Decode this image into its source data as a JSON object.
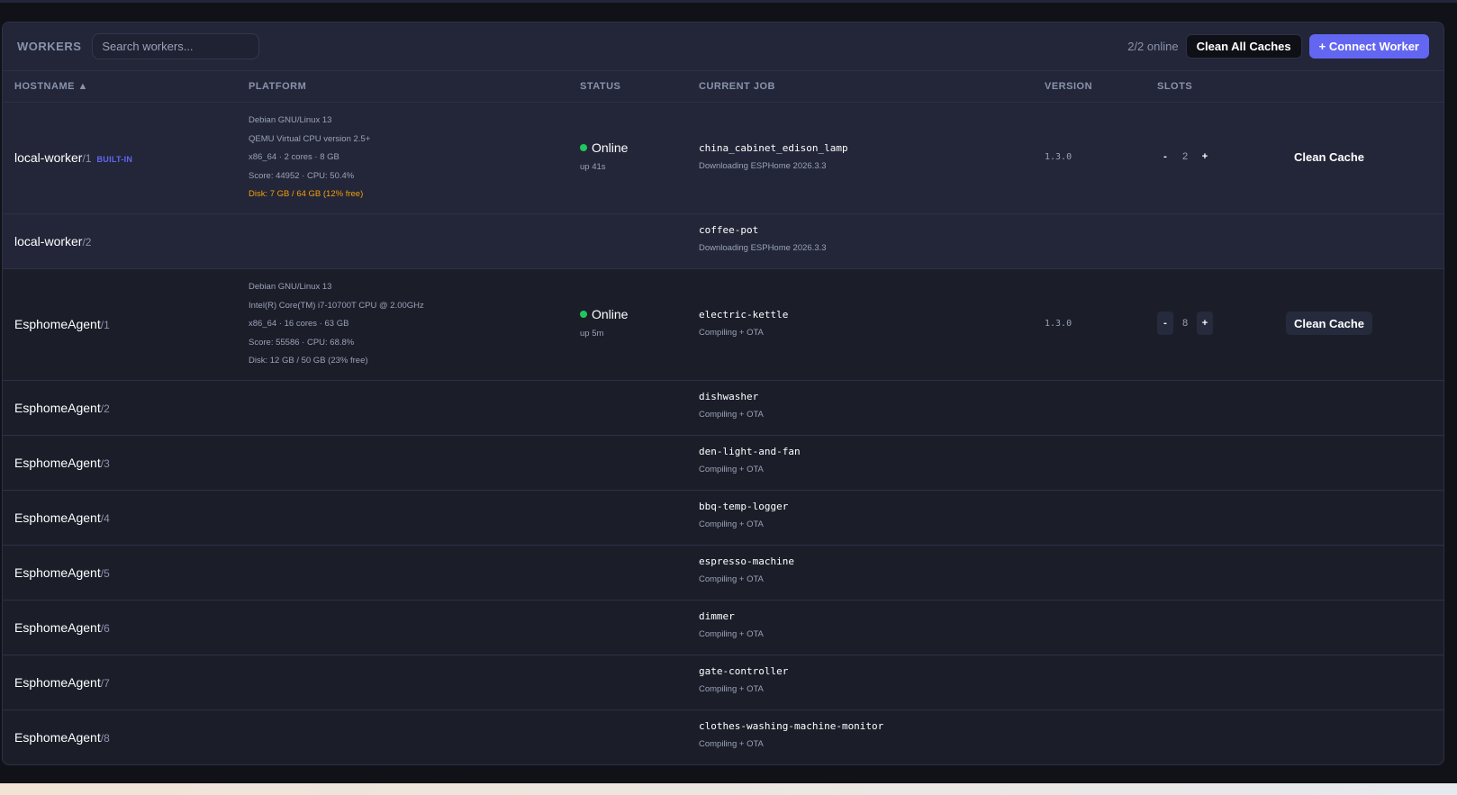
{
  "header": {
    "title": "WORKERS",
    "search_placeholder": "Search workers...",
    "online": "2/2 online",
    "clean_all": "Clean All Caches",
    "connect": "+ Connect Worker"
  },
  "columns": {
    "hostname": "HOSTNAME ▲",
    "platform": "PLATFORM",
    "status": "STATUS",
    "job": "CURRENT JOB",
    "version": "VERSION",
    "slots": "SLOTS"
  },
  "workers": [
    {
      "host": "local-worker",
      "idx": "/1",
      "badge": "BUILT-IN",
      "platform": [
        "Debian GNU/Linux 13",
        "QEMU Virtual CPU version 2.5+",
        "x86_64 · 2 cores · 8 GB",
        "Score: 44952 · CPU: 50.4%"
      ],
      "disk": "Disk: 7 GB / 64 GB (12% free)",
      "status": "Online",
      "uptime": "up 41s",
      "job": "china_cabinet_edison_lamp",
      "job_status": "Downloading ESPHome 2026.3.3",
      "version": "1.3.0",
      "slots": "2",
      "clean": "Clean Cache"
    },
    {
      "host": "local-worker",
      "idx": "/2",
      "job": "coffee-pot",
      "job_status": "Downloading ESPHome 2026.3.3"
    },
    {
      "host": "EsphomeAgent",
      "idx": "/1",
      "platform": [
        "Debian GNU/Linux 13",
        "Intel(R) Core(TM) i7-10700T CPU @ 2.00GHz",
        "x86_64 · 16 cores · 63 GB",
        "Score: 55586 · CPU: 68.8%"
      ],
      "disk": "Disk: 12 GB / 50 GB (23% free)",
      "status": "Online",
      "uptime": "up 5m",
      "job": "electric-kettle",
      "job_status": "Compiling + OTA",
      "version": "1.3.0",
      "slots": "8",
      "clean": "Clean Cache"
    },
    {
      "host": "EsphomeAgent",
      "idx": "/2",
      "job": "dishwasher",
      "job_status": "Compiling + OTA"
    },
    {
      "host": "EsphomeAgent",
      "idx": "/3",
      "job": "den-light-and-fan",
      "job_status": "Compiling + OTA"
    },
    {
      "host": "EsphomeAgent",
      "idx": "/4",
      "job": "bbq-temp-logger",
      "job_status": "Compiling + OTA"
    },
    {
      "host": "EsphomeAgent",
      "idx": "/5",
      "job": "espresso-machine",
      "job_status": "Compiling + OTA"
    },
    {
      "host": "EsphomeAgent",
      "idx": "/6",
      "job": "dimmer",
      "job_status": "Compiling + OTA"
    },
    {
      "host": "EsphomeAgent",
      "idx": "/7",
      "job": "gate-controller",
      "job_status": "Compiling + OTA"
    },
    {
      "host": "EsphomeAgent",
      "idx": "/8",
      "job": "clothes-washing-machine-monitor",
      "job_status": "Compiling + OTA"
    }
  ],
  "slot_controls": {
    "minus": "-",
    "plus": "+"
  }
}
